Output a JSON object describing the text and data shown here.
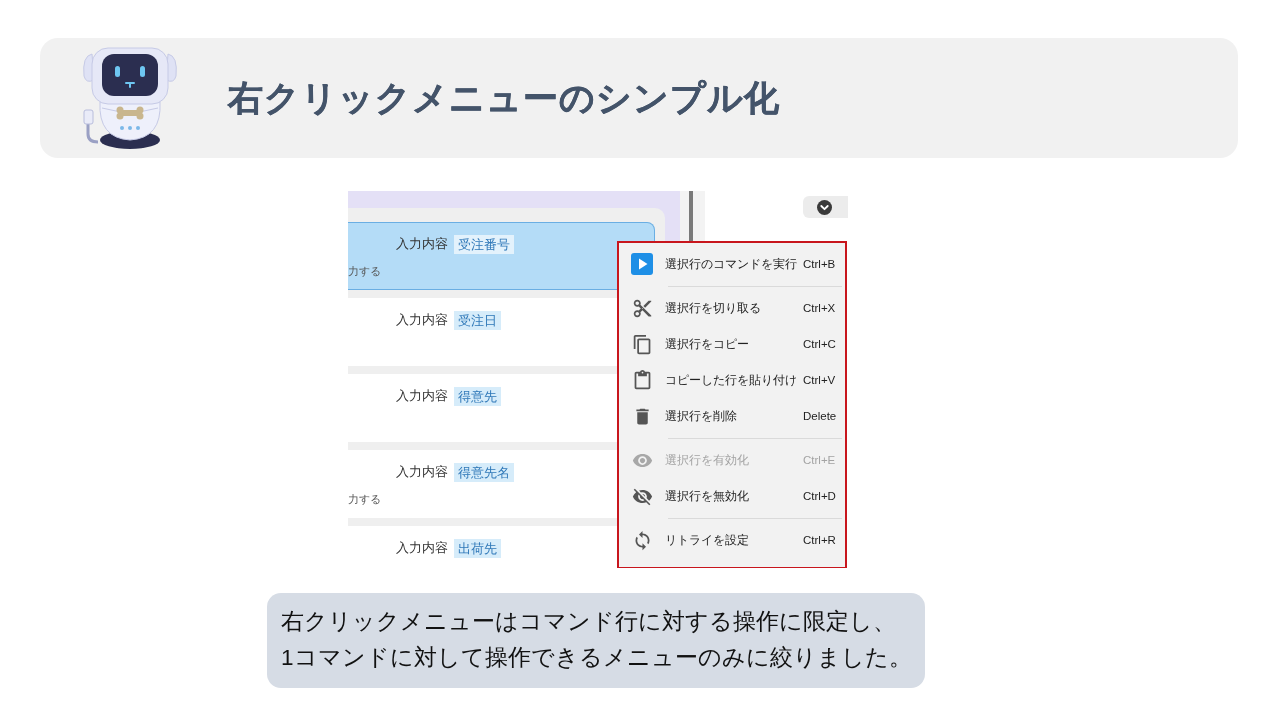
{
  "header": {
    "title": "右クリックメニューのシンプル化"
  },
  "screenshot": {
    "rows": [
      {
        "label": "入力内容",
        "value": "受注番号",
        "description": "力する",
        "selected": true
      },
      {
        "label": "入力内容",
        "value": "受注日",
        "selected": false
      },
      {
        "label": "入力内容",
        "value": "得意先",
        "selected": false
      },
      {
        "label": "入力内容",
        "value": "得意先名",
        "description": "力する",
        "selected": false
      },
      {
        "label": "入力内容",
        "value": "出荷先",
        "selected": false
      }
    ],
    "context_menu": {
      "groups": [
        {
          "items": [
            {
              "label": "選択行のコマンドを実行",
              "shortcut": "Ctrl+B",
              "disabled": false
            }
          ]
        },
        {
          "items": [
            {
              "label": "選択行を切り取る",
              "shortcut": "Ctrl+X",
              "disabled": false
            },
            {
              "label": "選択行をコピー",
              "shortcut": "Ctrl+C",
              "disabled": false
            },
            {
              "label": "コピーした行を貼り付け",
              "shortcut": "Ctrl+V",
              "disabled": false
            },
            {
              "label": "選択行を削除",
              "shortcut": "Delete",
              "disabled": false
            }
          ]
        },
        {
          "items": [
            {
              "label": "選択行を有効化",
              "shortcut": "Ctrl+E",
              "disabled": true
            },
            {
              "label": "選択行を無効化",
              "shortcut": "Ctrl+D",
              "disabled": false
            }
          ]
        },
        {
          "items": [
            {
              "label": "リトライを設定",
              "shortcut": "Ctrl+R",
              "disabled": false
            }
          ]
        }
      ]
    }
  },
  "caption": "右クリックメニューはコマンド行に対する操作に限定し、\n1コマンドに対して操作できるメニューのみに絞りました。"
}
